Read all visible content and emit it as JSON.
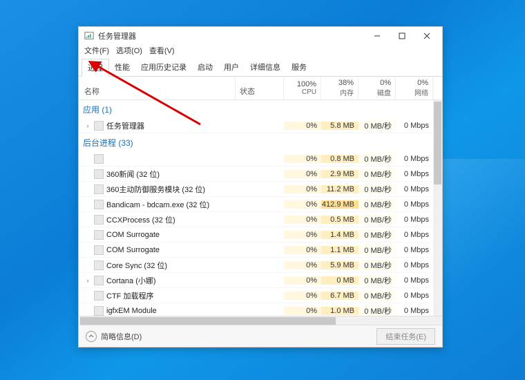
{
  "window": {
    "title": "任务管理器"
  },
  "menu": {
    "file": "文件(F)",
    "options": "选项(O)",
    "view": "查看(V)"
  },
  "tabs": {
    "items": [
      {
        "label": "进程",
        "active": true
      },
      {
        "label": "性能",
        "active": false
      },
      {
        "label": "应用历史记录",
        "active": false
      },
      {
        "label": "启动",
        "active": false
      },
      {
        "label": "用户",
        "active": false
      },
      {
        "label": "详细信息",
        "active": false
      },
      {
        "label": "服务",
        "active": false
      }
    ]
  },
  "columns": {
    "name": "名称",
    "status": "状态",
    "cpu": {
      "pct": "100%",
      "label": "CPU"
    },
    "mem": {
      "pct": "38%",
      "label": "内存"
    },
    "disk": {
      "pct": "0%",
      "label": "磁盘"
    },
    "net": {
      "pct": "0%",
      "label": "网络"
    }
  },
  "groups": {
    "apps": {
      "label": "应用 (1)"
    },
    "background": {
      "label": "后台进程 (33)"
    }
  },
  "processes": [
    {
      "group": "apps",
      "name": "任务管理器",
      "expand": true,
      "cpu": "0%",
      "mem": "5.8 MB",
      "mem_hi": false,
      "disk": "0 MB/秒",
      "net": "0 Mbps"
    },
    {
      "group": "bg",
      "name": "",
      "expand": false,
      "cpu": "0%",
      "mem": "0.8 MB",
      "mem_hi": false,
      "disk": "0 MB/秒",
      "net": "0 Mbps"
    },
    {
      "group": "bg",
      "name": "360新闻 (32 位)",
      "expand": false,
      "cpu": "0%",
      "mem": "2.9 MB",
      "mem_hi": false,
      "disk": "0 MB/秒",
      "net": "0 Mbps"
    },
    {
      "group": "bg",
      "name": "360主动防御服务模块 (32 位)",
      "expand": false,
      "cpu": "0%",
      "mem": "11.2 MB",
      "mem_hi": false,
      "disk": "0 MB/秒",
      "net": "0 Mbps"
    },
    {
      "group": "bg",
      "name": "Bandicam - bdcam.exe (32 位)",
      "expand": false,
      "cpu": "0%",
      "mem": "412.9 MB",
      "mem_hi": true,
      "disk": "0 MB/秒",
      "net": "0 Mbps"
    },
    {
      "group": "bg",
      "name": "CCXProcess (32 位)",
      "expand": false,
      "cpu": "0%",
      "mem": "0.5 MB",
      "mem_hi": false,
      "disk": "0 MB/秒",
      "net": "0 Mbps"
    },
    {
      "group": "bg",
      "name": "COM Surrogate",
      "expand": false,
      "cpu": "0%",
      "mem": "1.4 MB",
      "mem_hi": false,
      "disk": "0 MB/秒",
      "net": "0 Mbps"
    },
    {
      "group": "bg",
      "name": "COM Surrogate",
      "expand": false,
      "cpu": "0%",
      "mem": "1.1 MB",
      "mem_hi": false,
      "disk": "0 MB/秒",
      "net": "0 Mbps"
    },
    {
      "group": "bg",
      "name": "Core Sync (32 位)",
      "expand": false,
      "cpu": "0%",
      "mem": "5.9 MB",
      "mem_hi": false,
      "disk": "0 MB/秒",
      "net": "0 Mbps"
    },
    {
      "group": "bg",
      "name": "Cortana (小娜)",
      "expand": true,
      "cpu": "0%",
      "mem": "0 MB",
      "mem_hi": false,
      "disk": "0 MB/秒",
      "net": "0 Mbps"
    },
    {
      "group": "bg",
      "name": "CTF 加载程序",
      "expand": false,
      "cpu": "0%",
      "mem": "6.7 MB",
      "mem_hi": false,
      "disk": "0 MB/秒",
      "net": "0 Mbps"
    },
    {
      "group": "bg",
      "name": "igfxEM Module",
      "expand": false,
      "cpu": "0%",
      "mem": "1.0 MB",
      "mem_hi": false,
      "disk": "0 MB/秒",
      "net": "0 Mbps"
    }
  ],
  "footer": {
    "fewer_details": "简略信息(D)",
    "end_task": "结束任务(E)"
  }
}
